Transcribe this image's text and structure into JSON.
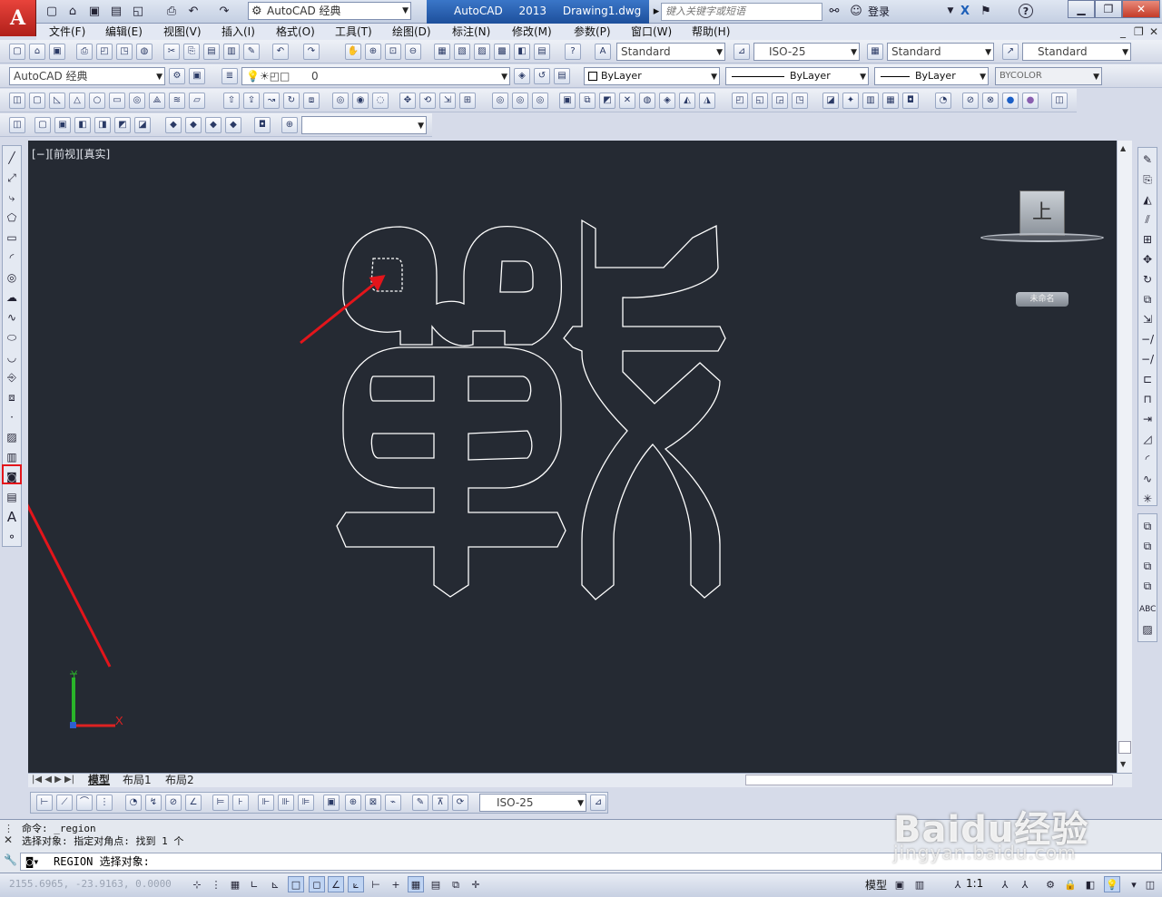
{
  "titlebar": {
    "app_letter": "A",
    "workspace_combo": "AutoCAD 经典",
    "title_text": "AutoCAD 2013    Drawing1.dwg",
    "search_placeholder": "键入关键字或短语",
    "login_label": "登录",
    "help_label": "?"
  },
  "menubar": {
    "items": [
      "文件(F)",
      "编辑(E)",
      "视图(V)",
      "插入(I)",
      "格式(O)",
      "工具(T)",
      "绘图(D)",
      "标注(N)",
      "修改(M)",
      "参数(P)",
      "窗口(W)",
      "帮助(H)"
    ]
  },
  "toolbar1": {
    "text_style": "Standard",
    "dim_style": "ISO-25",
    "table_style": "Standard",
    "multileader_style": "Standard"
  },
  "toolbar2": {
    "workspace": "AutoCAD 经典",
    "layer_value": "0",
    "color": "ByLayer",
    "linetype": "ByLayer",
    "lineweight": "ByLayer",
    "plotstyle": "BYCOLOR"
  },
  "viewport": {
    "label": "[−][前视][真实]",
    "nav_cube_face": "上",
    "ucs_name": "未命名",
    "axis_x": "X",
    "axis_y": "Y"
  },
  "tabs": {
    "model": "模型",
    "layout1": "布局1",
    "layout2": "布局2"
  },
  "dim_toolbar": {
    "dim_style": "ISO-25"
  },
  "command": {
    "history_line1": "命令: _region",
    "history_line2": "选择对象: 指定对角点: 找到 1 个",
    "prompt": "REGION 选择对象:"
  },
  "statusbar": {
    "coords": "2155.6965, -23.9163, 0.0000",
    "space_label": "模型",
    "annotation_scale": "1:1"
  },
  "watermark": {
    "main": "Baidu经验",
    "sub": "jingyan.baidu.com"
  },
  "colors": {
    "viewport_bg": "#252a33",
    "drawing_stroke": "#ffffff",
    "annotation_red": "#e3151b"
  }
}
